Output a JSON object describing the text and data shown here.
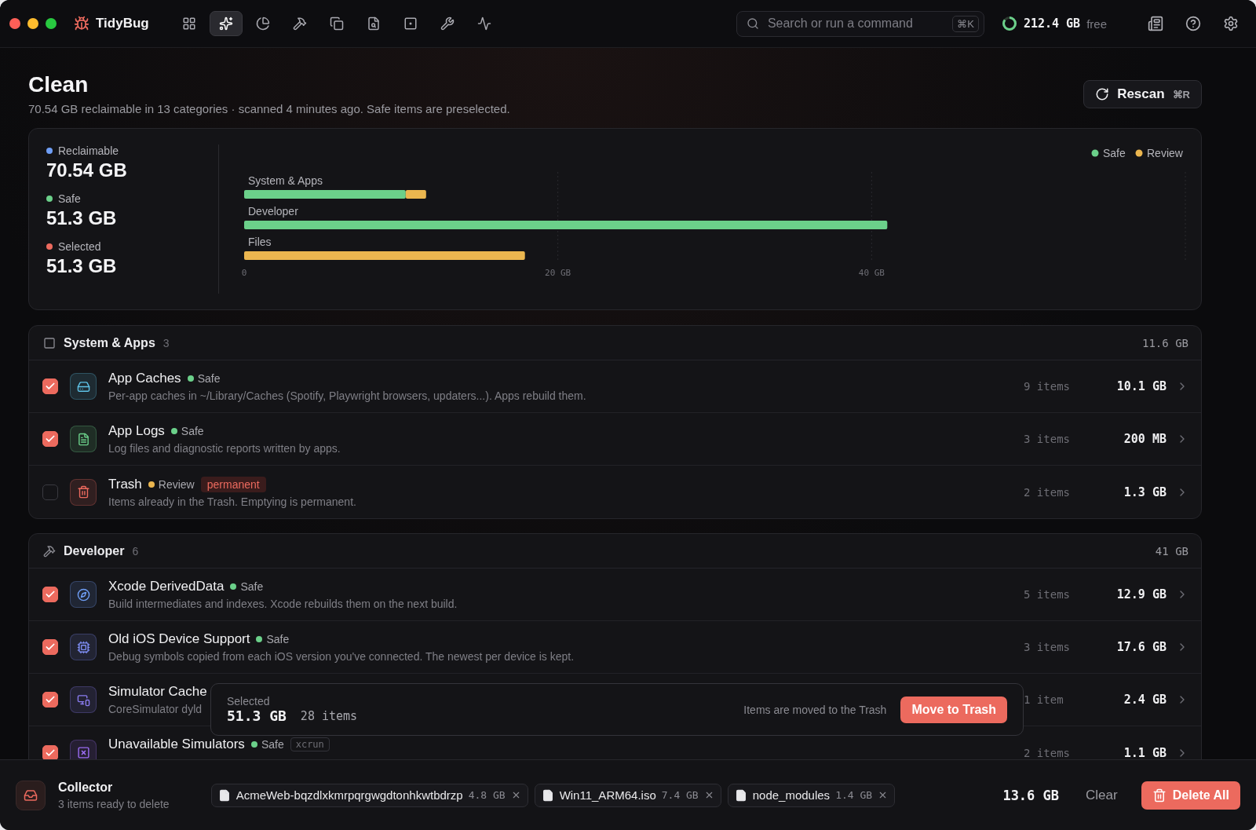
{
  "app": {
    "name": "TidyBug"
  },
  "nav": [
    {
      "selected": false
    },
    {
      "selected": true
    },
    {
      "selected": false
    },
    {
      "selected": false
    },
    {
      "selected": false
    },
    {
      "selected": false
    },
    {
      "selected": false
    },
    {
      "selected": false
    },
    {
      "selected": false
    }
  ],
  "search": {
    "placeholder": "Search or run a command",
    "shortcut": "⌘K"
  },
  "disk": {
    "value": "212.4 GB",
    "unit": "free",
    "level": 0.85
  },
  "header": {
    "title": "Clean",
    "subtitle": "70.54 GB reclaimable in 13 categories · scanned 4 minutes ago. Safe items are preselected.",
    "rescan": {
      "label": "Rescan",
      "shortcut": "⌘R"
    }
  },
  "summary": {
    "stats": [
      {
        "label": "Reclaimable",
        "value": "70.54 GB",
        "color": "#6f9ef5"
      },
      {
        "label": "Safe",
        "value": "51.3 GB",
        "color": "#6bd08a"
      },
      {
        "label": "Selected",
        "value": "51.3 GB",
        "color": "#ec6a5e"
      }
    ],
    "chart_data": {
      "type": "bar",
      "orientation": "horizontal",
      "stacked": true,
      "categories": [
        "System & Apps",
        "Developer",
        "Files"
      ],
      "series": [
        {
          "name": "Safe",
          "color": "#6bd08a",
          "values": [
            10.3,
            41,
            0
          ]
        },
        {
          "name": "Review",
          "color": "#ebb64f",
          "values": [
            1.3,
            0,
            17.9
          ]
        }
      ],
      "legend": "top-right",
      "xlim": [
        0,
        60
      ],
      "xticks": [
        {
          "value": 0,
          "label": "0"
        },
        {
          "value": 20,
          "label": "20 GB"
        },
        {
          "value": 40,
          "label": "40 GB"
        }
      ]
    }
  },
  "groups": [
    {
      "kind": "system",
      "title": "System & Apps",
      "count": "3",
      "total": "11.6 GB",
      "rows": [
        {
          "name": "App Caches",
          "badge": {
            "label": "Safe",
            "color": "#6bd08a"
          },
          "description": "Per-app caches in ~/Library/Caches (Spotify, Playwright browsers, updaters...). Apps rebuild them.",
          "items": "9 items",
          "size": "10.1 GB",
          "checked": true,
          "color": "#5fc3e8"
        },
        {
          "name": "App Logs",
          "badge": {
            "label": "Safe",
            "color": "#6bd08a"
          },
          "description": "Log files and diagnostic reports written by apps.",
          "items": "3 items",
          "size": "200 MB",
          "checked": true,
          "color": "#6bd08a"
        },
        {
          "name": "Trash",
          "badge": {
            "label": "Review",
            "color": "#ebb64f"
          },
          "tag": {
            "text": "permanent",
            "kind": "danger"
          },
          "description": "Items already in the Trash. Emptying is permanent.",
          "items": "2 items",
          "size": "1.3 GB",
          "checked": false,
          "color": "#ec6a5e"
        }
      ]
    },
    {
      "kind": "developer",
      "title": "Developer",
      "count": "6",
      "total": "41 GB",
      "rows": [
        {
          "name": "Xcode DerivedData",
          "badge": {
            "label": "Safe",
            "color": "#6bd08a"
          },
          "description": "Build intermediates and indexes. Xcode rebuilds them on the next build.",
          "items": "5 items",
          "size": "12.9 GB",
          "checked": true,
          "color": "#6f9ef5"
        },
        {
          "name": "Old iOS Device Support",
          "badge": {
            "label": "Safe",
            "color": "#6bd08a"
          },
          "description": "Debug symbols copied from each iOS version you've connected. The newest per device is kept.",
          "items": "3 items",
          "size": "17.6 GB",
          "checked": true,
          "color": "#7d8cf0"
        },
        {
          "name": "Simulator Cache",
          "description": "CoreSimulator dyld",
          "items": "1 item",
          "size": "2.4 GB",
          "checked": true,
          "color": "#8a7cf0"
        },
        {
          "name": "Unavailable Simulators",
          "badge": {
            "label": "Safe",
            "color": "#6bd08a"
          },
          "tag": {
            "text": "xcrun",
            "kind": "code"
          },
          "items": "2 items",
          "size": "1.1 GB",
          "checked": true,
          "color": "#9a6cf0"
        }
      ]
    }
  ],
  "selection_bar": {
    "label": "Selected",
    "size": "51.3 GB",
    "items": "28 items",
    "note": "Items are moved to the Trash",
    "button": "Move to Trash"
  },
  "collector": {
    "title": "Collector",
    "subtitle": "3 items ready to delete",
    "files": [
      {
        "name": "AcmeWeb-bqzdlxkmrpqrgwgdtonhkwtbdrzp",
        "size": "4.8 GB"
      },
      {
        "name": "Win11_ARM64.iso",
        "size": "7.4 GB"
      },
      {
        "name": "node_modules",
        "size": "1.4 GB"
      }
    ],
    "total": "13.6 GB",
    "clear": "Clear",
    "delete": "Delete All"
  }
}
